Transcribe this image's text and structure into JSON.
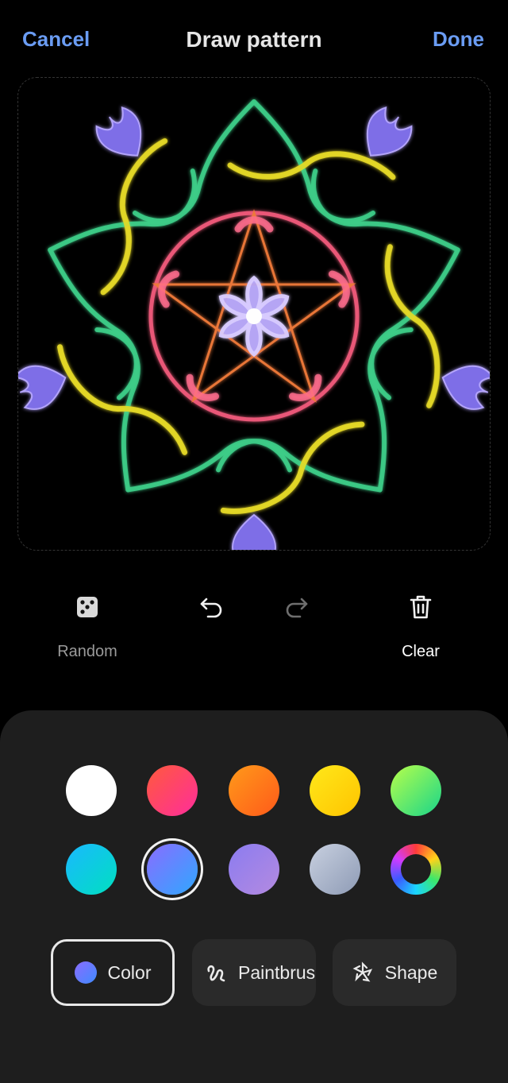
{
  "header": {
    "cancel": "Cancel",
    "title": "Draw pattern",
    "done": "Done"
  },
  "tools": {
    "random": "Random",
    "clear": "Clear"
  },
  "palette": {
    "row1": [
      "white",
      "pink-red",
      "orange",
      "yellow",
      "green"
    ],
    "row2": [
      "cyan",
      "blue-violet",
      "lavender",
      "grey-blue",
      "color-picker"
    ],
    "selected": "blue-violet"
  },
  "modes": {
    "color": "Color",
    "paintbrush": "Paintbrush",
    "shape": "Shape"
  },
  "colors": {
    "accent": "#6a9cf3",
    "panel": "#1e1e1e"
  }
}
